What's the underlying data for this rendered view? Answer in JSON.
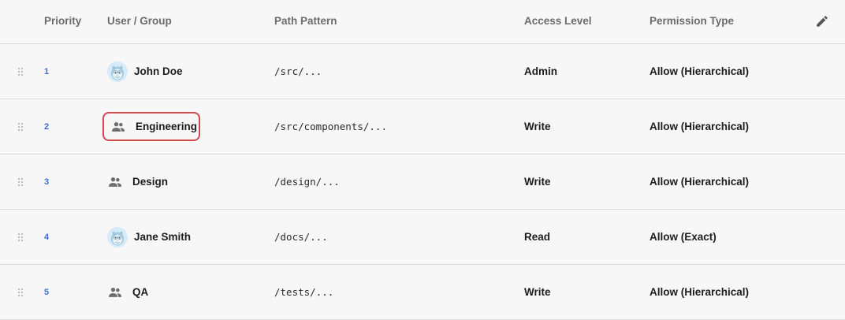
{
  "header": {
    "priority": "Priority",
    "user_group": "User / Group",
    "path_pattern": "Path Pattern",
    "access_level": "Access Level",
    "permission_type": "Permission Type"
  },
  "rows": [
    {
      "priority": "1",
      "kind": "user",
      "name": "John Doe",
      "path": "/src/...",
      "access": "Admin",
      "permission": "Allow (Hierarchical)"
    },
    {
      "priority": "2",
      "kind": "group",
      "name": "Engineering",
      "path": "/src/components/...",
      "access": "Write",
      "permission": "Allow (Hierarchical)",
      "selected": true
    },
    {
      "priority": "3",
      "kind": "group",
      "name": "Design",
      "path": "/design/...",
      "access": "Write",
      "permission": "Allow (Hierarchical)"
    },
    {
      "priority": "4",
      "kind": "user",
      "name": "Jane Smith",
      "path": "/docs/...",
      "access": "Read",
      "permission": "Allow (Exact)"
    },
    {
      "priority": "5",
      "kind": "group",
      "name": "QA",
      "path": "/tests/...",
      "access": "Write",
      "permission": "Allow (Hierarchical)"
    }
  ],
  "icons": {
    "drag": "drag-handle-icon",
    "user": "user-avatar-icon",
    "group": "group-icon",
    "edit": "pencil-icon"
  },
  "colors": {
    "priority": "#3b6fd6",
    "selection_border": "#cf4a4f",
    "header_text": "#6b6b6b",
    "background": "#f7f7f7"
  }
}
